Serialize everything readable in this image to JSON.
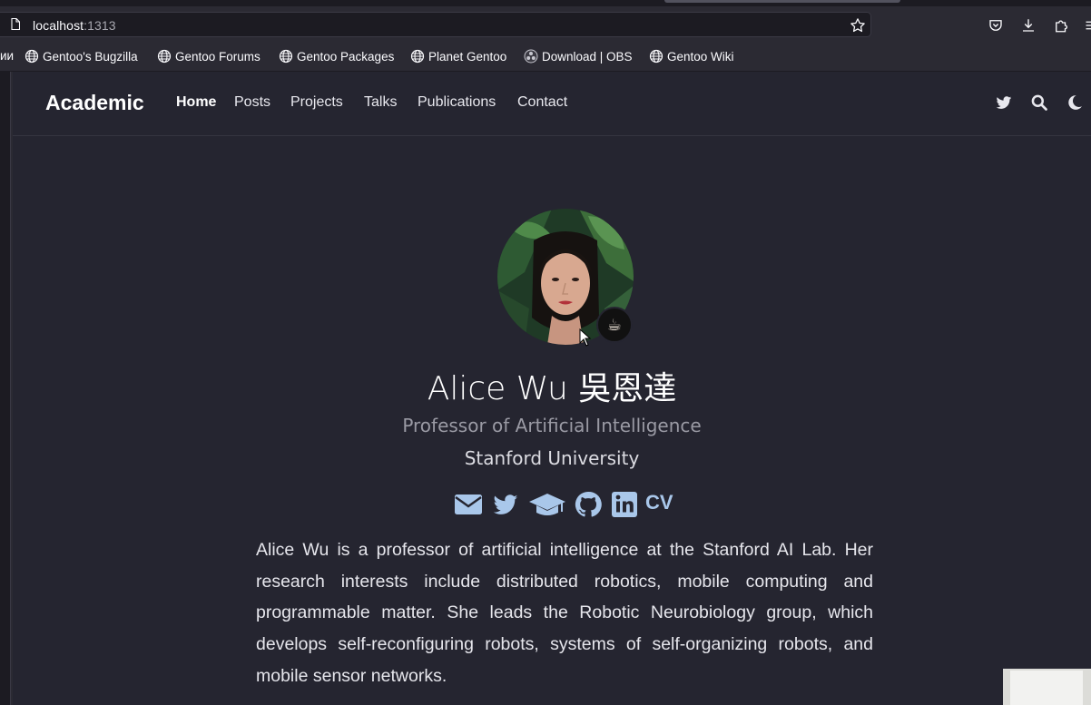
{
  "browser": {
    "url_host": "localhost",
    "url_port": ":1313",
    "bookmarks_cut_label": "ии",
    "bookmarks": [
      {
        "label": "Gentoo's Bugzilla",
        "icon": "globe-icon"
      },
      {
        "label": "Gentoo Forums",
        "icon": "globe-icon"
      },
      {
        "label": "Gentoo Packages",
        "icon": "globe-icon"
      },
      {
        "label": "Planet Gentoo",
        "icon": "globe-icon"
      },
      {
        "label": "Download | OBS",
        "icon": "obs-icon"
      },
      {
        "label": "Gentoo Wiki",
        "icon": "globe-icon"
      }
    ],
    "toolbar_icons": [
      "pocket-icon",
      "download-icon",
      "extensions-icon",
      "menu-icon"
    ]
  },
  "site": {
    "brand": "Academic",
    "nav": [
      {
        "label": "Home",
        "active": true
      },
      {
        "label": "Posts"
      },
      {
        "label": "Projects"
      },
      {
        "label": "Talks"
      },
      {
        "label": "Publications"
      },
      {
        "label": "Contact"
      }
    ],
    "nav_icons": [
      "twitter-icon",
      "search-icon",
      "moon-icon"
    ]
  },
  "profile": {
    "name": "Alice Wu 吳恩達",
    "role": "Professor of Artificial Intelligence",
    "organization": "Stanford University",
    "status_emoji": "☕",
    "social_icons": [
      "envelope-icon",
      "twitter-icon",
      "graduation-cap-icon",
      "github-icon",
      "linkedin-icon"
    ],
    "cv_label": "CV",
    "bio": "Alice Wu is a professor of artificial intelligence at the Stanford AI Lab. Her research interests include distributed robotics, mobile computing and programmable matter. She leads the Robotic Neurobiology group, which develops self-reconfiguring robots, systems of self-organizing robots, and mobile sensor networks."
  },
  "colors": {
    "background": "#252530",
    "accent": "#a9c7ea",
    "chrome": "#2b2a33"
  }
}
